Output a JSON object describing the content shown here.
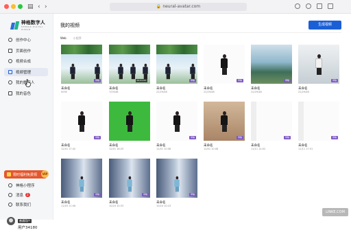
{
  "browser": {
    "url": "neural-avatar.com"
  },
  "sidebar": {
    "logo": {
      "name": "神格数字人",
      "tagline": "SHENGE DIGITAL HUMAN"
    },
    "items": [
      {
        "label": "创作中心",
        "icon": "home-icon",
        "active": false
      },
      {
        "label": "页面创作",
        "icon": "page-icon",
        "active": false
      },
      {
        "label": "视频合成",
        "icon": "video-icon",
        "active": false
      },
      {
        "label": "视频管理",
        "icon": "folder-icon",
        "active": true
      },
      {
        "label": "我的数字人",
        "icon": "user-icon",
        "active": false
      },
      {
        "label": "我的音色",
        "icon": "voice-icon",
        "active": false
      }
    ],
    "promo": {
      "label": "限时福利免费领",
      "badge": "VIP"
    },
    "footer": [
      {
        "label": "神格小程序",
        "icon": "miniapp-icon"
      },
      {
        "label": "消息",
        "icon": "bell-icon",
        "badge": "2"
      },
      {
        "label": "联系我们",
        "icon": "contact-icon"
      }
    ],
    "user": {
      "vip": "普通用户",
      "name": "用户34180"
    }
  },
  "main": {
    "title": "我的视频",
    "generate_button": "生成视频",
    "tabs": [
      "Web",
      "小程序"
    ],
    "cards": [
      {
        "name": "未命名",
        "date": "0095",
        "tag": "草稿",
        "duration": "",
        "scene": "outdoor",
        "figures": 2
      },
      {
        "name": "未命名",
        "date": "7/29/48",
        "tag": "",
        "duration": "00:01:02",
        "scene": "outdoor",
        "figures": 3
      },
      {
        "name": "未命名",
        "date": "22/29/48",
        "tag": "草稿",
        "duration": "",
        "scene": "outdoor",
        "figures": 2
      },
      {
        "name": "未命名",
        "date": "22/29/48",
        "tag": "草稿",
        "duration": "",
        "scene": "white",
        "figures": 1
      },
      {
        "name": "未命名",
        "date": "22/29/48",
        "tag": "草稿",
        "duration": "",
        "scene": "lake",
        "figures": 0
      },
      {
        "name": "未命名",
        "date": "22/29/48",
        "tag": "草稿",
        "duration": "",
        "scene": "hall",
        "figures": 1
      },
      {
        "name": "未命名",
        "date": "12/01 17:42",
        "tag": "草稿",
        "duration": "",
        "scene": "white",
        "figures": 1
      },
      {
        "name": "未命名",
        "date": "12/01 16:25",
        "tag": "",
        "duration": "",
        "scene": "green",
        "figures": 1
      },
      {
        "name": "未命名",
        "date": "12/01 10:08",
        "tag": "草稿",
        "duration": "",
        "scene": "white",
        "figures": 1
      },
      {
        "name": "未命名",
        "date": "12/01 10:08",
        "tag": "草稿",
        "duration": "",
        "scene": "room",
        "figures": 1
      },
      {
        "name": "未命名",
        "date": "11/11 14:02",
        "tag": "草稿",
        "duration": "",
        "scene": "blank",
        "figures": 0
      },
      {
        "name": "未命名",
        "date": "11/11 17:51",
        "tag": "草稿",
        "duration": "",
        "scene": "blank",
        "figures": 0
      },
      {
        "name": "未命名",
        "date": "11/03 11:06",
        "tag": "草稿",
        "duration": "",
        "scene": "corridor",
        "figures": 1
      },
      {
        "name": "未命名",
        "date": "10/24 10:33",
        "tag": "草稿",
        "duration": "",
        "scene": "corridor",
        "figures": 1
      },
      {
        "name": "未命名",
        "date": "10/24 10:23",
        "tag": "草稿",
        "duration": "",
        "scene": "corridor",
        "figures": 1
      }
    ]
  },
  "watermark": "LINKE.COM",
  "colors": {
    "accent": "#1b5fd6",
    "tag": "#7e57c2",
    "promo": "#e4572e"
  }
}
